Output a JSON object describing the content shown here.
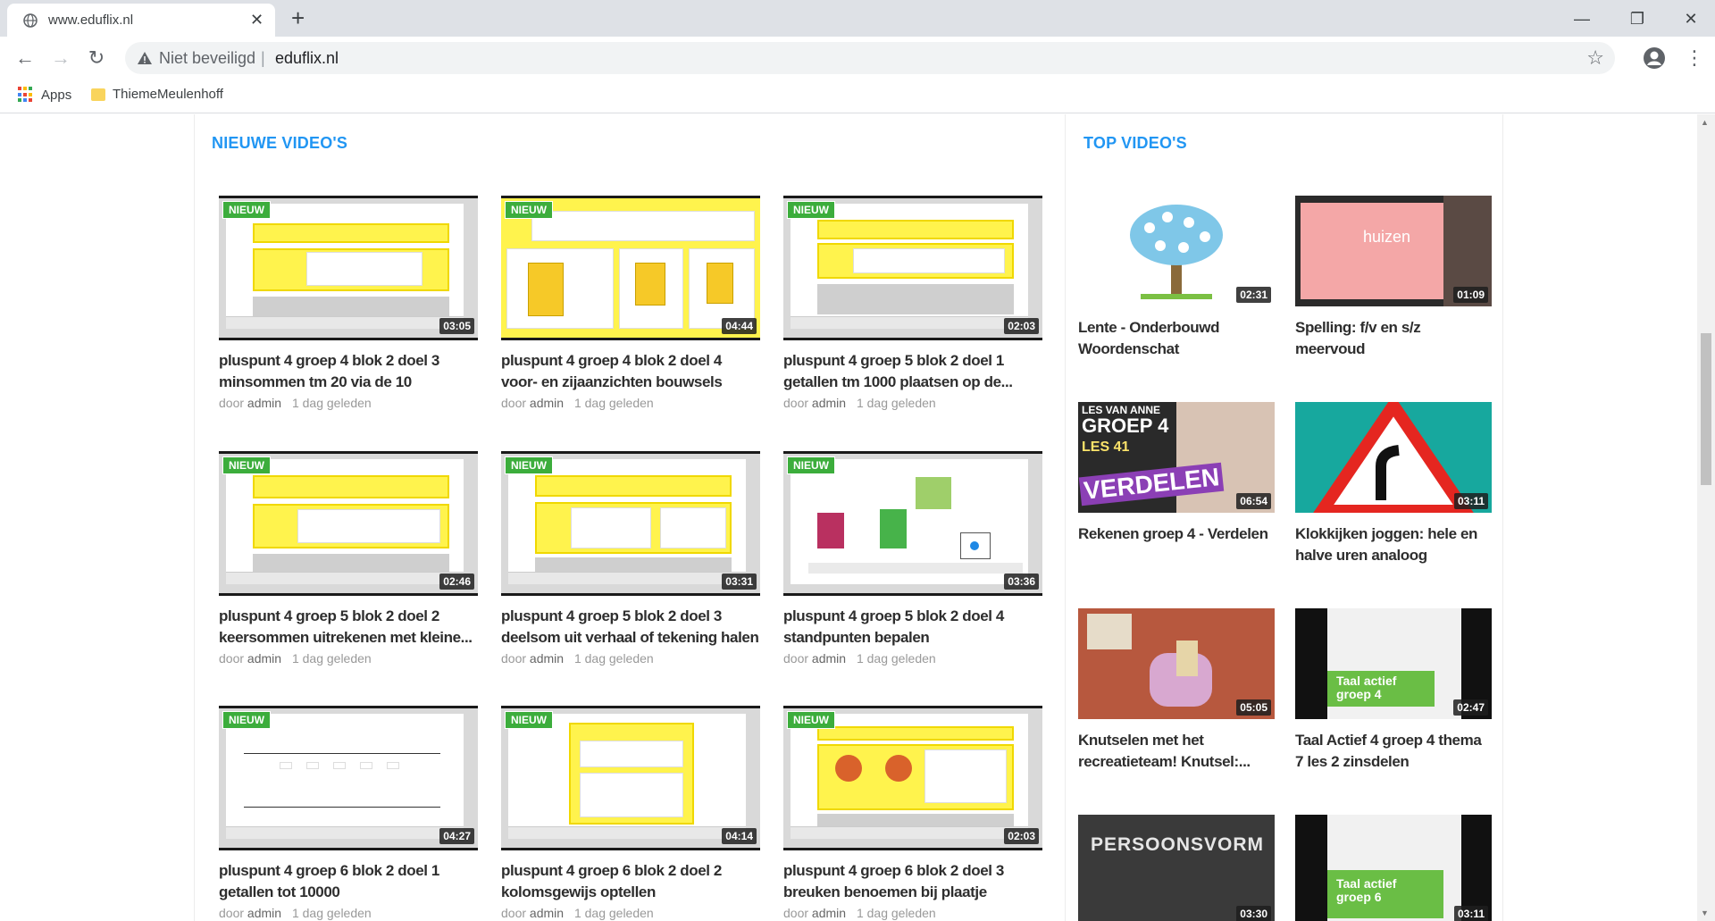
{
  "browser": {
    "tab_title": "www.eduflix.nl",
    "tab_close": "✕",
    "new_tab": "+",
    "window_minimize": "—",
    "window_restore": "❐",
    "window_close": "✕",
    "nav_back": "←",
    "nav_forward": "→",
    "nav_reload": "↻",
    "security_text": "Niet beveiligd",
    "separator": "|",
    "url": "eduflix.nl",
    "bookmark_star": "☆",
    "menu": "⋮",
    "bookmarks": [
      {
        "label": "Apps"
      },
      {
        "label": "ThiemeMeulenhoff"
      }
    ]
  },
  "sections": {
    "new_videos_title": "NIEUWE VIDEO'S",
    "top_videos_title": "TOP VIDEO'S"
  },
  "new_videos": [
    {
      "badge": "NIEUW",
      "duration": "03:05",
      "title": "pluspunt 4 groep 4 blok 2 doel 3 minsommen tm 20 via de 10",
      "by": "door",
      "author": "admin",
      "time": "1 dag geleden"
    },
    {
      "badge": "NIEUW",
      "duration": "04:44",
      "title": "pluspunt 4 groep 4 blok 2 doel 4 voor- en zijaanzichten bouwsels",
      "by": "door",
      "author": "admin",
      "time": "1 dag geleden"
    },
    {
      "badge": "NIEUW",
      "duration": "02:03",
      "title": "pluspunt 4 groep 5 blok 2 doel 1 getallen tm 1000 plaatsen op de...",
      "by": "door",
      "author": "admin",
      "time": "1 dag geleden"
    },
    {
      "badge": "NIEUW",
      "duration": "02:46",
      "title": "pluspunt 4 groep 5 blok 2 doel 2 keersommen uitrekenen met kleine...",
      "by": "door",
      "author": "admin",
      "time": "1 dag geleden"
    },
    {
      "badge": "NIEUW",
      "duration": "03:31",
      "title": "pluspunt 4 groep 5 blok 2 doel 3 deelsom uit verhaal of tekening halen",
      "by": "door",
      "author": "admin",
      "time": "1 dag geleden"
    },
    {
      "badge": "NIEUW",
      "duration": "03:36",
      "title": "pluspunt 4 groep 5 blok 2 doel 4 standpunten bepalen",
      "by": "door",
      "author": "admin",
      "time": "1 dag geleden"
    },
    {
      "badge": "NIEUW",
      "duration": "04:27",
      "title": "pluspunt 4 groep 6 blok 2 doel 1 getallen tot 10000",
      "by": "door",
      "author": "admin",
      "time": "1 dag geleden"
    },
    {
      "badge": "NIEUW",
      "duration": "04:14",
      "title": "pluspunt 4 groep 6 blok 2 doel 2 kolomsgewijs optellen",
      "by": "door",
      "author": "admin",
      "time": "1 dag geleden"
    },
    {
      "badge": "NIEUW",
      "duration": "02:03",
      "title": "pluspunt 4 groep 6 blok 2 doel 3 breuken benoemen bij plaatje",
      "by": "door",
      "author": "admin",
      "time": "1 dag geleden"
    }
  ],
  "top_videos": [
    {
      "duration": "02:31",
      "title": "Lente - Onderbouwd Woordenschat"
    },
    {
      "duration": "01:09",
      "title": "Spelling: f/v en s/z meervoud",
      "thumb_text": "huizen"
    },
    {
      "duration": "06:54",
      "title": "Rekenen groep 4 - Verdelen",
      "thumb_line1": "LES VAN ANNE",
      "thumb_line2": "GROEP 4",
      "thumb_line3": "LES 41",
      "thumb_line4": "VERDELEN"
    },
    {
      "duration": "03:11",
      "title": "Klokkijken joggen: hele en halve uren analoog"
    },
    {
      "duration": "05:05",
      "title": "Knutselen met het recreatieteam! Knutsel:..."
    },
    {
      "duration": "02:47",
      "title": "Taal Actief 4 groep 4 thema 7 les 2 zinsdelen",
      "thumb_text": "Taal actief groep 4"
    },
    {
      "duration": "03:30",
      "title": "",
      "thumb_text": "PERSOONSVORM"
    },
    {
      "duration": "03:11",
      "title": "",
      "thumb_text": "Taal actief groep 6"
    }
  ],
  "colors": {
    "accent": "#2196f3",
    "badge": "#3cad3c",
    "slide_yellow": "#fff34d"
  }
}
